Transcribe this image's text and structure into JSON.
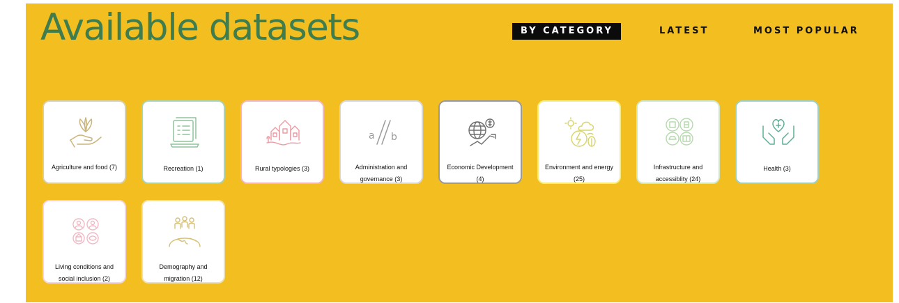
{
  "header": {
    "title": "Available datasets",
    "tabs": [
      {
        "label": "BY CATEGORY",
        "active": true
      },
      {
        "label": "LATEST",
        "active": false
      },
      {
        "label": "MOST POPULAR",
        "active": false
      }
    ]
  },
  "colors": {
    "background": "#f3be1f",
    "title": "#3f7d4f",
    "active_tab_bg": "#0b0b0b"
  },
  "categories": [
    {
      "label": "Agriculture and food (7)",
      "icon": "hand-plant-icon",
      "border": "#d9cfa8"
    },
    {
      "label": "Recreation (1)",
      "icon": "document-list-icon",
      "border": "#a9d3b2"
    },
    {
      "label": "Rural typologies (3)",
      "icon": "village-icon",
      "border": "#f3b8bd"
    },
    {
      "label": "Administration and governance (3)",
      "icon": "a-slash-b-icon",
      "border": "#d7d7d7"
    },
    {
      "label": "Economic Development (4)",
      "icon": "globe-growth-icon",
      "border": "#9a9a9a"
    },
    {
      "label": "Environment and energy (25)",
      "icon": "environment-energy-icon",
      "border": "#f5ec79"
    },
    {
      "label": "Infrastructure and accessiblity (24)",
      "icon": "infrastructure-icon",
      "border": "#cfe7c8"
    },
    {
      "label": "Health (3)",
      "icon": "hands-heart-icon",
      "border": "#9fd0c4"
    },
    {
      "label": "Living conditions and social inclusion (2)",
      "icon": "social-inclusion-icon",
      "border": "#f6d6dc"
    },
    {
      "label": "Demography and migration (12)",
      "icon": "people-globe-icon",
      "border": "#efe0b0"
    }
  ]
}
